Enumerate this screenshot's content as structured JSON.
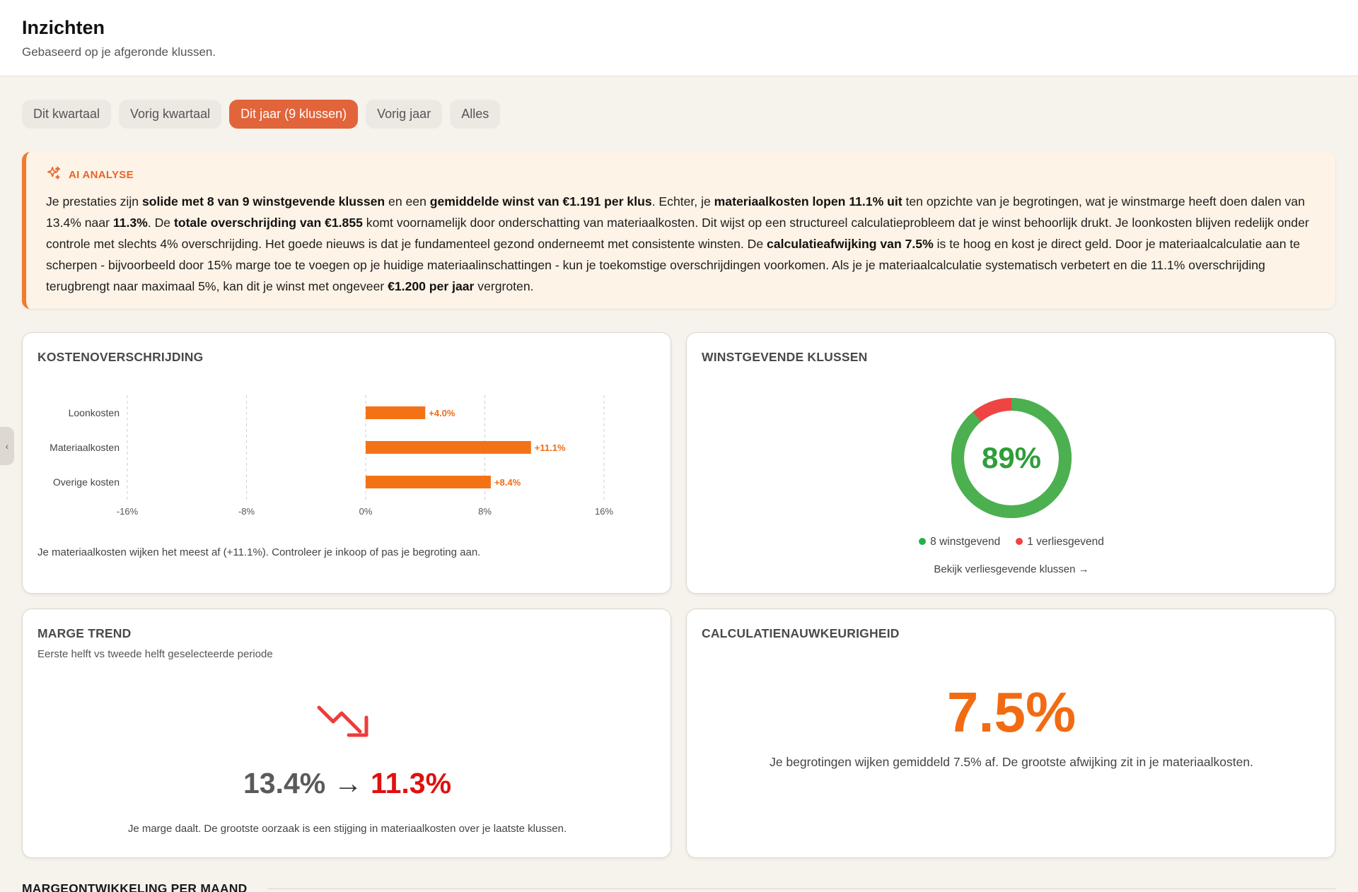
{
  "header": {
    "title": "Inzichten",
    "subtitle": "Gebaseerd op je afgeronde klussen."
  },
  "filters": [
    {
      "label": "Dit kwartaal",
      "active": false
    },
    {
      "label": "Vorig kwartaal",
      "active": false
    },
    {
      "label": "Dit jaar (9 klussen)",
      "active": true
    },
    {
      "label": "Vorig jaar",
      "active": false
    },
    {
      "label": "Alles",
      "active": false
    }
  ],
  "ai": {
    "label": "AI ANALYSE",
    "icon": "sparkles-icon",
    "paragraph": [
      {
        "t": "Je prestaties zijn "
      },
      {
        "t": "solide met 8 van 9 winstgevende klussen",
        "b": true
      },
      {
        "t": " en een "
      },
      {
        "t": "gemiddelde winst van €1.191 per klus",
        "b": true
      },
      {
        "t": ". Echter, je "
      },
      {
        "t": "materiaalkosten lopen 11.1% uit",
        "b": true
      },
      {
        "t": " ten opzichte van je begrotingen, wat je winstmarge heeft doen dalen van 13.4% naar "
      },
      {
        "t": "11.3%",
        "b": true
      },
      {
        "t": ". De "
      },
      {
        "t": "totale overschrijding van €1.855",
        "b": true
      },
      {
        "t": " komt voornamelijk door onderschatting van materiaalkosten. Dit wijst op een structureel calculatieprobleem dat je winst behoorlijk drukt. Je loonkosten blijven redelijk onder controle met slechts 4% overschrijding. Het goede nieuws is dat je fundamenteel gezond onderneemt met consistente winsten. De "
      },
      {
        "t": "calculatieafwijking van 7.5%",
        "b": true
      },
      {
        "t": " is te hoog en kost je direct geld. Door je materiaalcalculatie aan te scherpen - bijvoorbeeld door 15% marge toe te voegen op je huidige materiaalinschattingen - kun je toekomstige overschrijdingen voorkomen. Als je je materiaalcalculatie systematisch verbetert en die 11.1% overschrijding terugbrengt naar maximaal 5%, kan dit je winst met ongeveer "
      },
      {
        "t": "€1.200 per jaar",
        "b": true
      },
      {
        "t": " vergroten."
      }
    ]
  },
  "cost": {
    "title": "KOSTENOVERSCHRIJDING",
    "note": "Je materiaalkosten wijken het meest af (+11.1%). Controleer je inkoop of pas je begroting aan."
  },
  "chart_data": {
    "type": "bar",
    "orientation": "horizontal",
    "categories": [
      "Loonkosten",
      "Materiaalkosten",
      "Overige kosten"
    ],
    "values": [
      4.0,
      11.1,
      8.4
    ],
    "value_labels": [
      "+4.0%",
      "+11.1%",
      "+8.4%"
    ],
    "xlim": [
      -16,
      16
    ],
    "x_ticks": [
      -16,
      -8,
      0,
      8,
      16
    ],
    "x_tick_labels": [
      "-16%",
      "-8%",
      "0%",
      "8%",
      "16%"
    ],
    "grid": true,
    "bar_color": "#f47216"
  },
  "win": {
    "title": "WINSTGEVENDE KLUSSEN",
    "percent_label": "89%",
    "profitable_count": 8,
    "loss_count": 1,
    "legend_profit": "8 winstgevend",
    "legend_loss": "1 verliesgevend",
    "color_profit": "#4caf50",
    "color_loss": "#ef4444",
    "link": "Bekijk verliesgevende klussen →"
  },
  "trend": {
    "title": "MARGE TREND",
    "subtitle": "Eerste helft vs tweede helft geselecteerde periode",
    "icon": "trend-down-icon",
    "from": "13.4%",
    "arrow": "→",
    "to": "11.3%",
    "note": "Je marge daalt. De grootste oorzaak is een stijging in materiaalkosten over je laatste klussen."
  },
  "calc": {
    "title": "CALCULATIENAUWKEURIGHEID",
    "value": "7.5%",
    "note": "Je begrotingen wijken gemiddeld 7.5% af. De grootste afwijking zit in je materiaalkosten."
  },
  "next_section": {
    "title": "MARGEONTWIKKELING PER MAAND"
  }
}
